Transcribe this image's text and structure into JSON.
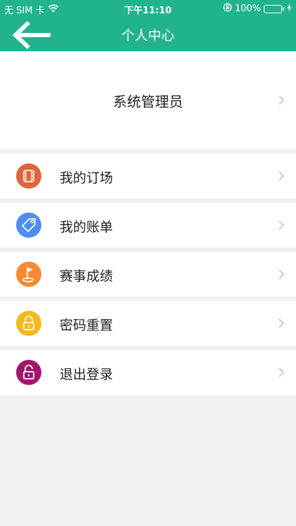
{
  "status_bar": {
    "carrier": "无 SIM 卡",
    "time": "下午11:10",
    "battery": "100%"
  },
  "nav": {
    "title": "个人中心"
  },
  "profile": {
    "name": "系统管理员"
  },
  "menu": [
    {
      "label": "我的订场",
      "icon": "film-icon",
      "color": "#e0653b"
    },
    {
      "label": "我的账单",
      "icon": "tag-icon",
      "color": "#4f8ef0"
    },
    {
      "label": "赛事成绩",
      "icon": "golf-flag-icon",
      "color": "#f58a34"
    },
    {
      "label": "密码重置",
      "icon": "lock-icon",
      "color": "#f7b91b"
    },
    {
      "label": "退出登录",
      "icon": "unlock-icon",
      "color": "#a0166e"
    }
  ],
  "colors": {
    "header": "#21b38e",
    "background": "#efeff4"
  }
}
